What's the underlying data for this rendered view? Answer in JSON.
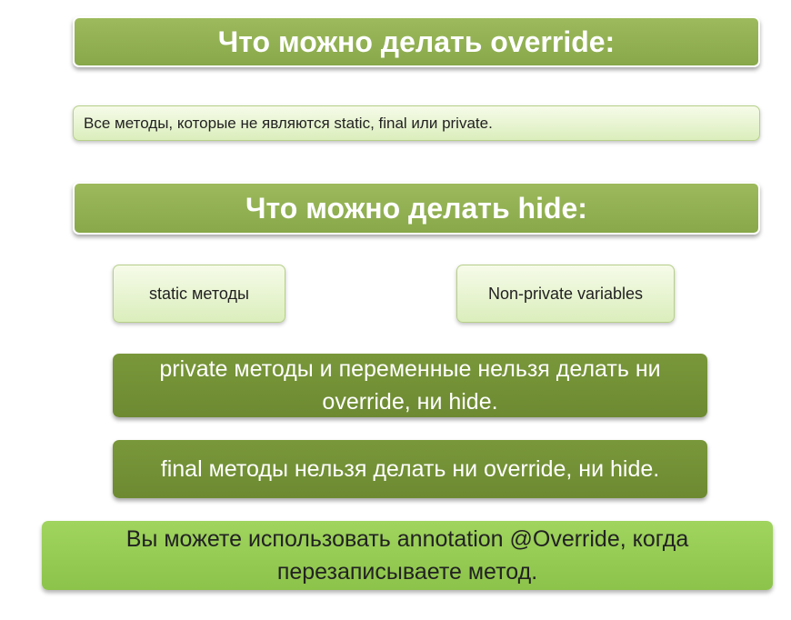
{
  "override_header": "Что можно делать override:",
  "override_desc": "Все методы, которые не являются static, final или private.",
  "hide_header": "Что можно делать hide:",
  "hide_items": [
    "static методы",
    "Non-private variables"
  ],
  "note_private": "private методы и переменные нельзя делать ни override, ни hide.",
  "note_final": "final методы нельзя делать ни override, ни hide.",
  "note_annotation": "Вы можете использовать annotation @Override, когда перезаписываете метод."
}
